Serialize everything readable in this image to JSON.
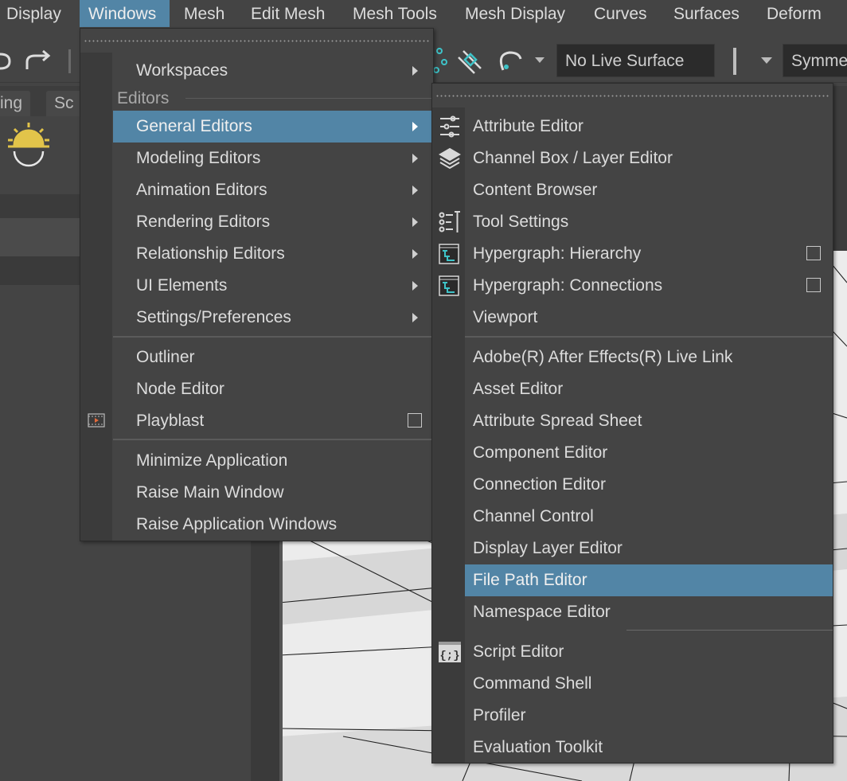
{
  "menubar": {
    "items": [
      "Display",
      "Windows",
      "Mesh",
      "Edit Mesh",
      "Mesh Tools",
      "Mesh Display",
      "Curves",
      "Surfaces",
      "Deform"
    ],
    "active": "Windows"
  },
  "toolbar": {
    "live_surface": "No Live Surface",
    "symmetry": "Symme"
  },
  "shelf_tabs": [
    "ing",
    "Sc"
  ],
  "windows_menu": {
    "workspaces": "Workspaces",
    "editors_section": "Editors",
    "items": [
      {
        "label": "General Editors",
        "submenu": true
      },
      {
        "label": "Modeling Editors",
        "submenu": true
      },
      {
        "label": "Animation Editors",
        "submenu": true
      },
      {
        "label": "Rendering Editors",
        "submenu": true
      },
      {
        "label": "Relationship Editors",
        "submenu": true
      },
      {
        "label": "UI Elements",
        "submenu": true
      },
      {
        "label": "Settings/Preferences",
        "submenu": true
      }
    ],
    "group2": [
      "Outliner",
      "Node Editor",
      "Playblast"
    ],
    "group3": [
      "Minimize Application",
      "Raise Main Window",
      "Raise Application Windows"
    ]
  },
  "general_editors_menu": {
    "group1": [
      {
        "label": "Attribute Editor",
        "icon": "attribute-editor-icon"
      },
      {
        "label": "Channel Box / Layer Editor",
        "icon": "channel-box-icon"
      },
      {
        "label": "Content Browser"
      },
      {
        "label": "Tool Settings",
        "icon": "tool-settings-icon"
      },
      {
        "label": "Hypergraph: Hierarchy",
        "icon": "hypergraph-icon",
        "checkbox": true
      },
      {
        "label": "Hypergraph: Connections",
        "icon": "hypergraph-icon",
        "checkbox": true
      },
      {
        "label": "Viewport"
      }
    ],
    "group2": [
      "Adobe(R) After Effects(R) Live Link",
      "Asset Editor",
      "Attribute Spread Sheet",
      "Component Editor",
      "Connection Editor",
      "Channel Control",
      "Display Layer Editor",
      "File Path Editor",
      "Namespace Editor"
    ],
    "highlighted": "File Path Editor",
    "group3": [
      "Script Editor",
      "Command Shell",
      "Profiler",
      "Evaluation Toolkit"
    ]
  },
  "colors": {
    "highlight": "#5285a6",
    "menu_bg": "#444444",
    "accent_icon": "#3ec3c8",
    "sun_icon": "#e2c44a"
  }
}
